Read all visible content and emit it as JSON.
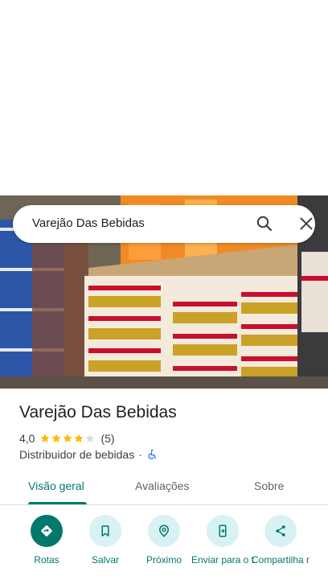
{
  "search": {
    "query": "Varejão Das Bebidas"
  },
  "place": {
    "title": "Varejão Das Bebidas",
    "rating_value": "4,0",
    "rating_stars": 4,
    "review_count": "(5)",
    "category": "Distribuidor de bebidas",
    "separator": "·"
  },
  "tabs": [
    {
      "label": "Visão geral",
      "active": true
    },
    {
      "label": "Avaliações",
      "active": false
    },
    {
      "label": "Sobre",
      "active": false
    }
  ],
  "actions": [
    {
      "label": "Rotas",
      "icon": "directions-icon"
    },
    {
      "label": "Salvar",
      "icon": "bookmark-icon"
    },
    {
      "label": "Próximo",
      "icon": "nearby-icon"
    },
    {
      "label": "Enviar para o t",
      "icon": "send-to-phone-icon"
    },
    {
      "label": "Compartilha r",
      "icon": "share-icon"
    }
  ],
  "colors": {
    "accent": "#00796b",
    "action_bg": "#d8f2f3",
    "star": "#fbbc04",
    "star_empty": "#dadce0"
  }
}
